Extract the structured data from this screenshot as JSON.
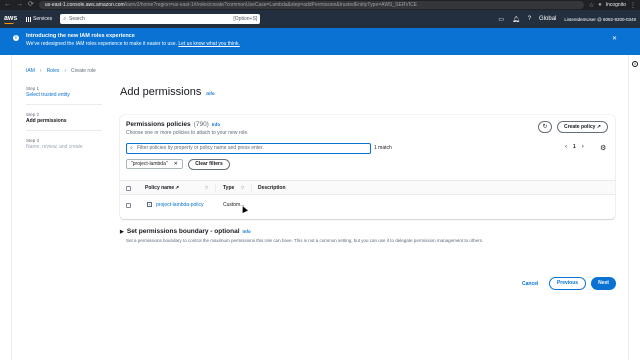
{
  "browser": {
    "url_host": "us-east-1.console.aws.amazon.com",
    "url_path": "/iamv2/home?region=us-east-1#/roles/create?commonUseCase=Lambda&step=addPermission&trustedEntityType=AWS_SERVICE",
    "profile_label": "Incognito"
  },
  "aws_nav": {
    "logo": "aws",
    "services_label": "Services",
    "search_placeholder": "Search",
    "search_shortcut": "[Option+S]",
    "region": "Global",
    "account": "ListenIdemUser @ 6092-9200-0349"
  },
  "flash": {
    "title": "Introducing the new IAM roles experience",
    "body": "We've redesigned the IAM roles experience to make it easier to use.",
    "link": "Let us know what you think."
  },
  "breadcrumb": [
    "IAM",
    "Roles",
    "Create role"
  ],
  "steps": [
    {
      "num": "Step 1",
      "label": "Select trusted entity",
      "state": "link"
    },
    {
      "num": "Step 2",
      "label": "Add permissions",
      "state": "current"
    },
    {
      "num": "Step 3",
      "label": "Name, review, and create",
      "state": "disabled"
    }
  ],
  "page": {
    "title": "Add permissions",
    "info": "Info"
  },
  "permissions": {
    "title": "Permissions policies",
    "count": "(790)",
    "info": "Info",
    "description": "Choose one or more policies to attach to your new role.",
    "create_policy": "Create policy",
    "filter_placeholder": "Filter policies by property or policy name and press enter.",
    "match_count": "1 match",
    "page": "1",
    "token": "\"project-lambda\"",
    "clear_filters": "Clear filters",
    "columns": [
      "Policy name",
      "Type",
      "Description"
    ],
    "rows": [
      {
        "name": "project-lambda-policy",
        "type": "Custom...",
        "description": ""
      }
    ]
  },
  "boundary": {
    "title": "Set permissions boundary - optional",
    "info": "Info",
    "description": "Set a permissions boundary to control the maximum permissions this role can have. This is not a common setting, but you can use it to delegate permission management to others."
  },
  "footer": {
    "cancel": "Cancel",
    "previous": "Previous",
    "next": "Next"
  },
  "colors": {
    "primary": "#0972d3",
    "nav_bg": "#232f3e",
    "aws_orange": "#ff9900"
  }
}
